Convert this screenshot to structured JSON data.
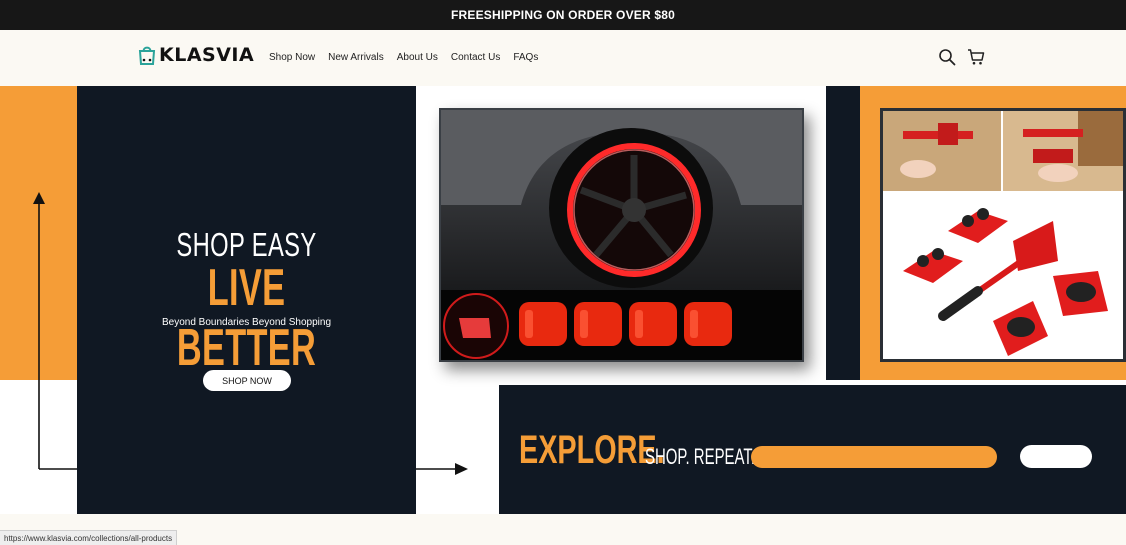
{
  "announcement": {
    "text": "FREESHIPPING ON ORDER OVER $80"
  },
  "header": {
    "brand": "KLASVIA",
    "nav": [
      {
        "label": "Shop Now"
      },
      {
        "label": "New Arrivals"
      },
      {
        "label": "About Us"
      },
      {
        "label": "Contact Us"
      },
      {
        "label": "FAQs"
      }
    ],
    "icons": [
      "search-icon",
      "cart-icon"
    ]
  },
  "hero": {
    "headline_top": "SHOP EASY",
    "headline_main": "LIVE BETTER",
    "tagline": "Beyond Boundaries Beyond Shopping",
    "cta_label": "SHOP NOW",
    "explore_text": "EXPLORE.",
    "repeat_text": "SHOP. REPEAT.",
    "colors": {
      "accent": "#f59d37",
      "dark": "#101823",
      "light": "#ffffff"
    }
  },
  "status_bar": {
    "url": "https://www.klasvia.com/collections/all-products"
  }
}
